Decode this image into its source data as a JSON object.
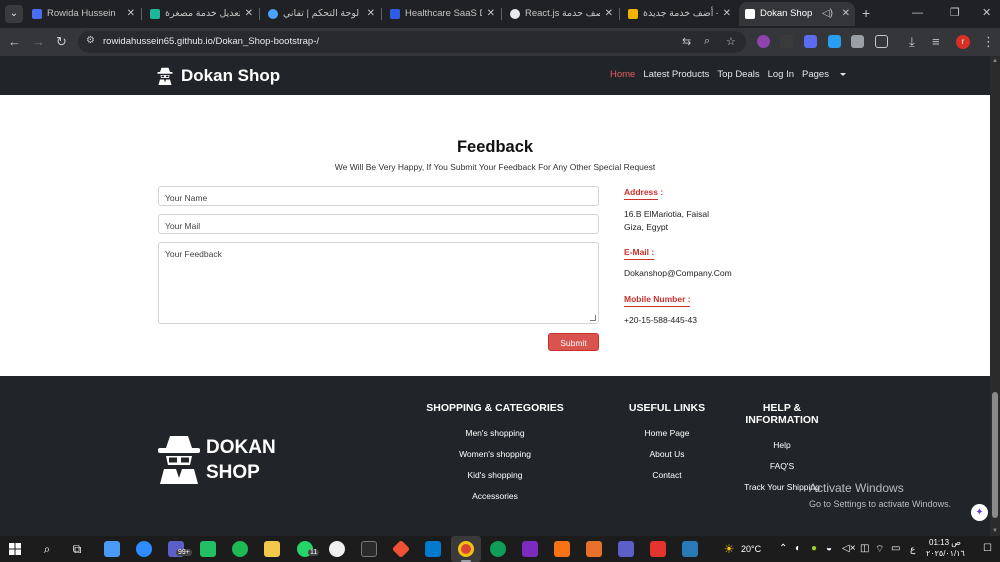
{
  "browser": {
    "tabs": [
      {
        "title": "Rowida Hussein",
        "color": "#4a6cf7"
      },
      {
        "title": "تعديل خدمة مصغرة",
        "color": "#1fb59a"
      },
      {
        "title": "لوحة التحكم | تفاني",
        "color": "#4aa3ff"
      },
      {
        "title": "Healthcare SaaS Dash",
        "color": "#2d5be3"
      },
      {
        "title": "React.js وصف حدمة",
        "color": "#e8eaed"
      },
      {
        "title": "أضف خدمة جديدة - ",
        "color": "#f0b400"
      },
      {
        "title": "Dokan Shop",
        "color": "#ffffff"
      }
    ],
    "url": "rowidahussein65.github.io/Dokan_Shop-bootstrap-/",
    "profile_initial": "r"
  },
  "site": {
    "brand": "Dokan Shop",
    "nav": [
      "Home",
      "Latest Products",
      "Top Deals",
      "Log In",
      "Pages"
    ],
    "colors": {
      "accent": "#d9534f",
      "dark": "#212529"
    }
  },
  "feedback": {
    "title": "Feedback",
    "subtitle": "We Will Be Very Happy, If You Submit Your Feedback For Any Other Special Request",
    "name_placeholder": "Your Name",
    "mail_placeholder": "Your Mail",
    "feedback_placeholder": "Your Feedback",
    "submit_label": "Submit",
    "address_label": "Address :",
    "address_line1": "16.B ElMariotia, Faisal",
    "address_line2": "Giza, Egypt",
    "email_label": "E-Mail :",
    "email_value": "Dokanshop@Company.Com",
    "mobile_label": "Mobile Number :",
    "mobile_value": "+20-15-588-445-43"
  },
  "footer": {
    "logo_line1": "DOKAN",
    "logo_line2": "SHOP",
    "shopping": {
      "title": "SHOPPING & CATEGORIES",
      "items": [
        "Men's shopping",
        "Women's shopping",
        "Kid's shopping",
        "Accessories"
      ]
    },
    "links": {
      "title": "USEFUL LINKS",
      "items": [
        "Home Page",
        "About Us",
        "Contact"
      ]
    },
    "help": {
      "title_line1": "HELP &",
      "title_line2": "INFORMATION",
      "items": [
        "Help",
        "FAQ'S",
        "Track Your Shipping"
      ]
    }
  },
  "watermark": {
    "line1": "Activate Windows",
    "line2": "Go to Settings to activate Windows."
  },
  "taskbar": {
    "weather": "20°C",
    "time": "01:13 ص",
    "date": "٢٠٢٥/٠١/١٦",
    "lang": "ع",
    "badge_mail": "99+",
    "badge_whatsapp": "11"
  }
}
